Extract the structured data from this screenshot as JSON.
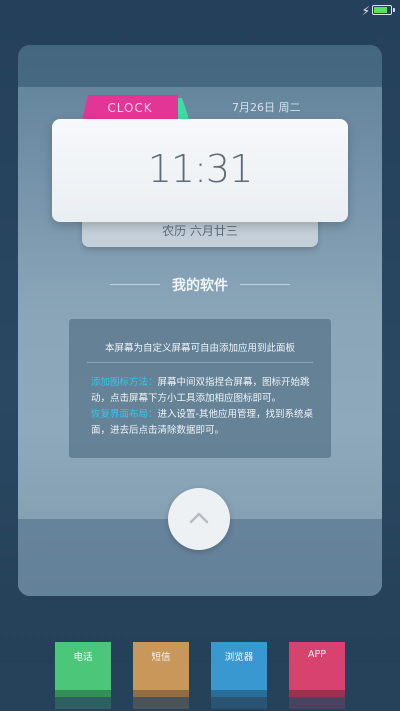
{
  "status_bar": {
    "battery_level": 0.85,
    "charging_icon": "bolt-icon",
    "colors": {
      "battery_fill": "#5fe05a"
    }
  },
  "clock_widget": {
    "tab_label": "CLOCK",
    "date": "7月26日 周二",
    "time": "11:31",
    "lunar_date": "农历 六月廿三",
    "colors": {
      "tab": "#e33595",
      "accent": "#3fdba4"
    }
  },
  "section": {
    "title": "我的软件"
  },
  "info": {
    "header": "本屏幕为自定义屏幕可自由添加应用到此面板",
    "tip1_label": "添加图标方法：",
    "tip1_text": "屏幕中间双指捏合屏幕，图标开始跳动，点击屏幕下方小工具添加相应图标即可。",
    "tip2_label": "恢复界面布局：",
    "tip2_text": "进入设置-其他应用管理，找到系统桌面，进去后点击清除数据即可。",
    "colors": {
      "highlight": "#35c7e8"
    }
  },
  "up_button": {
    "icon": "chevron-up-icon"
  },
  "dock": {
    "apps": [
      {
        "label": "电话",
        "color": "#4cc77a"
      },
      {
        "label": "短信",
        "color": "#c9975a"
      },
      {
        "label": "浏览器",
        "color": "#3a98d0"
      },
      {
        "label": "APP",
        "color": "#d8426e"
      }
    ]
  }
}
